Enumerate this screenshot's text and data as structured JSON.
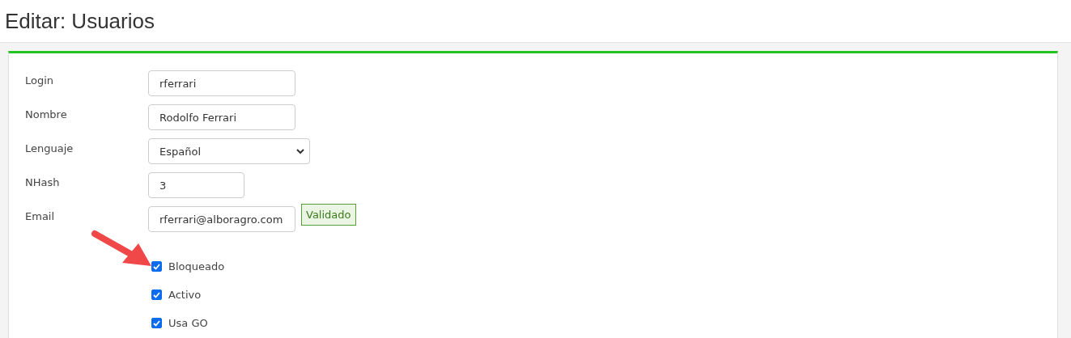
{
  "page_title": "Editar: Usuarios",
  "fields": [
    {
      "kind": "text",
      "label": "Login",
      "value": "rferrari"
    },
    {
      "kind": "text",
      "label": "Nombre",
      "value": "Rodolfo Ferrari"
    },
    {
      "kind": "select",
      "label": "Lenguaje",
      "value": "Español"
    },
    {
      "kind": "text",
      "label": "NHash",
      "value": "3"
    },
    {
      "kind": "text",
      "label": "Email",
      "value": "rferrari@alboragro.com",
      "badge": "Validado"
    }
  ],
  "checkboxes": [
    {
      "label": "Bloqueado",
      "checked": true
    },
    {
      "label": "Activo",
      "checked": true
    },
    {
      "label": "Usa GO",
      "checked": true
    }
  ]
}
